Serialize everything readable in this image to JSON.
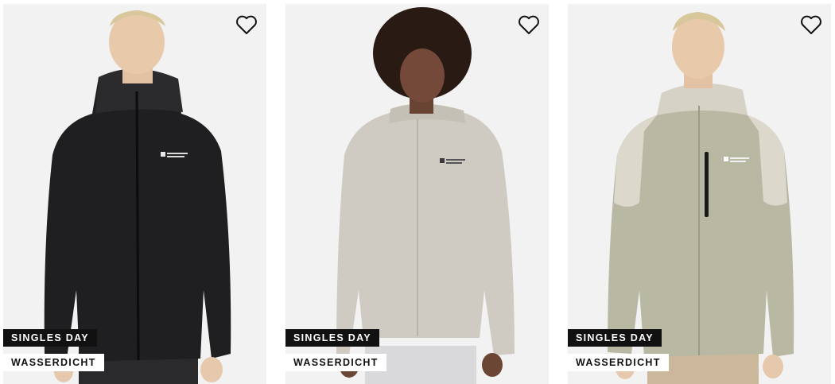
{
  "products": [
    {
      "brand_logo": "jack-wolfskin-logo",
      "jacket_color": "#1e1e20",
      "badges": {
        "sale": "SINGLES DAY",
        "feature": "WASSERDICHT"
      },
      "wishlist_icon": "heart-icon"
    },
    {
      "brand_logo": "jack-wolfskin-logo",
      "jacket_color": "#cfcbc2",
      "badges": {
        "sale": "SINGLES DAY",
        "feature": "WASSERDICHT"
      },
      "wishlist_icon": "heart-icon"
    },
    {
      "brand_logo": "jack-wolfskin-logo",
      "jacket_color": "#b9b8a3",
      "badges": {
        "sale": "SINGLES DAY",
        "feature": "WASSERDICHT"
      },
      "wishlist_icon": "heart-icon"
    }
  ],
  "colors": {
    "card_bg": "#f2f2f2",
    "badge_dark": "#111111",
    "badge_light": "#ffffff"
  }
}
